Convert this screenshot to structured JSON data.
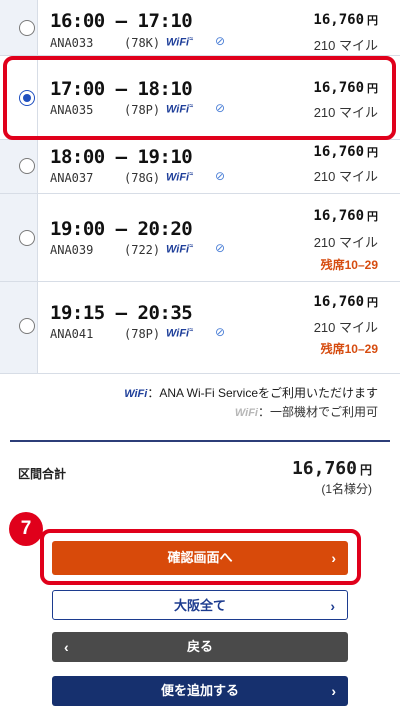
{
  "flights": [
    {
      "time": "16:00 – 17:10",
      "flight_no": "ANA033",
      "aircraft": "(78K)",
      "price": "16,760",
      "currency": "円",
      "miles": "210 マイル",
      "seats": "",
      "selected": false
    },
    {
      "time": "17:00 – 18:10",
      "flight_no": "ANA035",
      "aircraft": "(78P)",
      "price": "16,760",
      "currency": "円",
      "miles": "210 マイル",
      "seats": "",
      "selected": true
    },
    {
      "time": "18:00 – 19:10",
      "flight_no": "ANA037",
      "aircraft": "(78G)",
      "price": "16,760",
      "currency": "円",
      "miles": "210 マイル",
      "seats": "",
      "selected": false
    },
    {
      "time": "19:00 – 20:20",
      "flight_no": "ANA039",
      "aircraft": "(722)",
      "price": "16,760",
      "currency": "円",
      "miles": "210 マイル",
      "seats": "残席10–29",
      "selected": false
    },
    {
      "time": "19:15 – 20:35",
      "flight_no": "ANA041",
      "aircraft": "(78P)",
      "price": "16,760",
      "currency": "円",
      "miles": "210 マイル",
      "seats": "残席10–29",
      "selected": false
    }
  ],
  "wifi_label": "WiFi",
  "legend": {
    "line1_mark": "WiFi",
    "line1_text": "：ANA Wi-Fi Serviceをご利用いただけます",
    "line2_mark": "WiFi",
    "line2_text": "：一部機材でご利用可"
  },
  "total": {
    "label": "区間合計",
    "price": "16,760",
    "currency": "円",
    "note": "(1名様分)"
  },
  "step_badge": "7",
  "buttons": {
    "confirm": "確認画面へ",
    "osaka_all": "大阪全て",
    "back": "戻る",
    "add_flight": "便を追加する",
    "chevron_right": "›",
    "chevron_left": "‹"
  },
  "colors": {
    "accent_orange": "#d84a0a",
    "navy": "#16306e",
    "highlight_red": "#e0001b",
    "seats_orange": "#d64c10"
  }
}
